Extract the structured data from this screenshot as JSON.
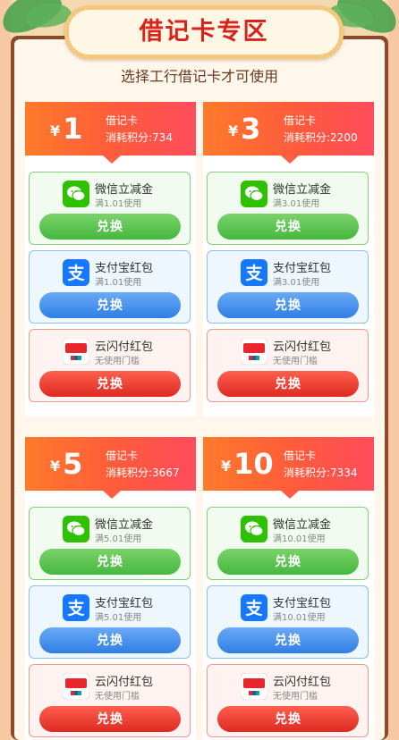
{
  "header": {
    "title": "借记卡专区",
    "subtitle": "选择工行借记卡才可使用"
  },
  "colors": {
    "accent_red": "#d8221a",
    "card_head_orange": "#ff7a2a",
    "card_head_pink": "#ff4c5c",
    "wechat_green": "#45b83f",
    "alipay_blue": "#2f7fe6",
    "yunshan_red": "#df2a22"
  },
  "cards": [
    {
      "currency": "¥",
      "amount": "1",
      "card_type": "借记卡",
      "cost": "消耗积分:734",
      "offers": [
        {
          "icon": "wechat-icon",
          "name": "微信立减金",
          "condition": "满1.01使用",
          "button": "兑换"
        },
        {
          "icon": "alipay-icon",
          "name": "支付宝红包",
          "condition": "满1.01使用",
          "button": "兑换"
        },
        {
          "icon": "yunshanfu-icon",
          "name": "云闪付红包",
          "condition": "无使用门槛",
          "button": "兑换"
        }
      ]
    },
    {
      "currency": "¥",
      "amount": "3",
      "card_type": "借记卡",
      "cost": "消耗积分:2200",
      "offers": [
        {
          "icon": "wechat-icon",
          "name": "微信立减金",
          "condition": "满3.01使用",
          "button": "兑换"
        },
        {
          "icon": "alipay-icon",
          "name": "支付宝红包",
          "condition": "满3.01使用",
          "button": "兑换"
        },
        {
          "icon": "yunshanfu-icon",
          "name": "云闪付红包",
          "condition": "无使用门槛",
          "button": "兑换"
        }
      ]
    },
    {
      "currency": "¥",
      "amount": "5",
      "card_type": "借记卡",
      "cost": "消耗积分:3667",
      "offers": [
        {
          "icon": "wechat-icon",
          "name": "微信立减金",
          "condition": "满5.01使用",
          "button": "兑换"
        },
        {
          "icon": "alipay-icon",
          "name": "支付宝红包",
          "condition": "满5.01使用",
          "button": "兑换"
        },
        {
          "icon": "yunshanfu-icon",
          "name": "云闪付红包",
          "condition": "无使用门槛",
          "button": "兑换"
        }
      ]
    },
    {
      "currency": "¥",
      "amount": "10",
      "card_type": "借记卡",
      "cost": "消耗积分:7334",
      "offers": [
        {
          "icon": "wechat-icon",
          "name": "微信立减金",
          "condition": "满10.01使用",
          "button": "兑换"
        },
        {
          "icon": "alipay-icon",
          "name": "支付宝红包",
          "condition": "满10.01使用",
          "button": "兑换"
        },
        {
          "icon": "yunshanfu-icon",
          "name": "云闪付红包",
          "condition": "无使用门槛",
          "button": "兑换"
        }
      ]
    }
  ]
}
